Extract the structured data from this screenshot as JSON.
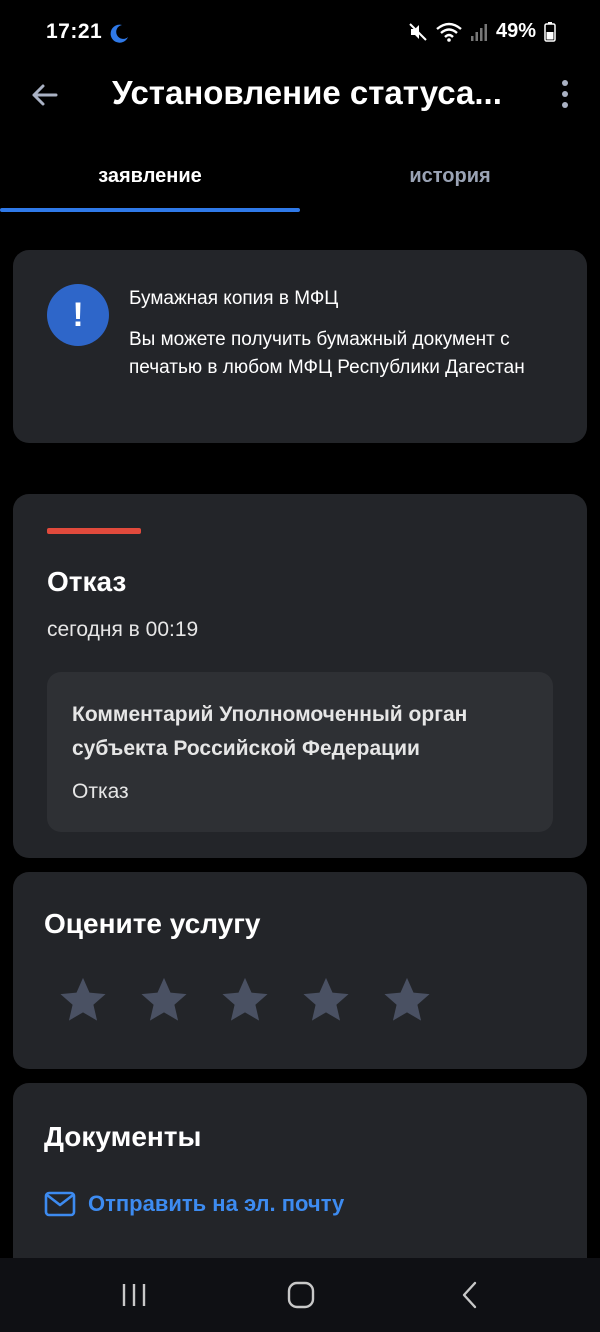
{
  "status_bar": {
    "time": "17:21",
    "battery": "49%",
    "icons": [
      "moon-icon",
      "mute-icon",
      "wifi-icon",
      "signal-icon",
      "battery-icon"
    ]
  },
  "app_bar": {
    "title": "Установление статуса...",
    "back_icon": "arrow-left-icon",
    "more_icon": "more-vertical-icon"
  },
  "tabs": [
    {
      "label": "заявление",
      "active": true
    },
    {
      "label": "история",
      "active": false
    }
  ],
  "info_card": {
    "icon": "exclamation-icon",
    "title": "Бумажная копия в МФЦ",
    "text": "Вы можете получить бумажный документ с печатью в любом МФЦ Республики Дагестан"
  },
  "status_card": {
    "title": "Отказ",
    "date": "сегодня в 00:19",
    "comment_title": "Комментарий Уполномоченный орган субъекта Российской Федерации",
    "comment_text": "Отказ",
    "accent": "#e14a3c"
  },
  "rating_card": {
    "title": "Оцените услугу",
    "stars": 5,
    "rating": 0
  },
  "documents_card": {
    "title": "Документы",
    "email_label": "Отправить на эл. почту",
    "email_icon": "mail-icon"
  },
  "nav_bar": [
    "recents-icon",
    "home-icon",
    "back-icon"
  ],
  "colors": {
    "accent": "#2f79e8",
    "link": "#3d8bf0",
    "card": "#232529",
    "star": "#4a5163"
  }
}
